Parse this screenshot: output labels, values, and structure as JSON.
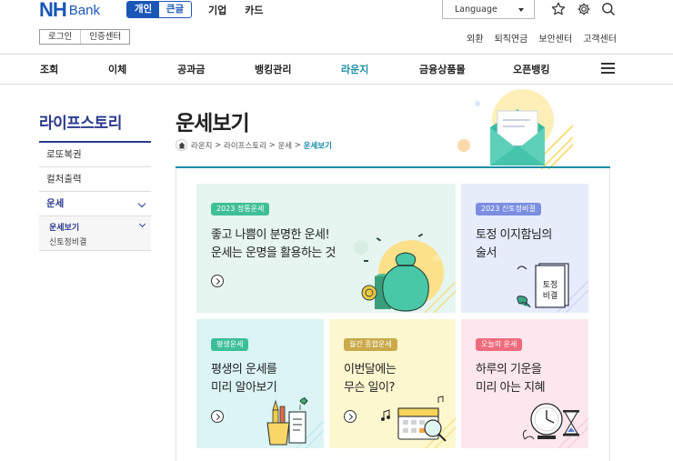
{
  "header": {
    "logo_main": "NH",
    "logo_sub": "Bank",
    "size_toggle": [
      "개인",
      "큰글"
    ],
    "top_links": [
      "기업",
      "카드"
    ],
    "language": "Language",
    "login": "로그인",
    "cert_center": "인증센터",
    "util_links": [
      "외환",
      "퇴직연금",
      "보안센터",
      "고객센터"
    ]
  },
  "gnb": [
    "조회",
    "이체",
    "공과금",
    "뱅킹관리",
    "라운지",
    "금융상품몰",
    "오픈뱅킹"
  ],
  "sidebar": {
    "title": "라이프스토리",
    "items": [
      "로또복권",
      "컬처출력",
      "운세"
    ],
    "sub_items": [
      "운세보기",
      "신토정비결"
    ]
  },
  "main": {
    "title": "운세보기",
    "breadcrumb": [
      "라운지",
      "라이프스토리",
      "운세",
      "운세보기"
    ]
  },
  "cards": [
    {
      "tag": "2023 정통운세",
      "lines": [
        "좋고 나쁨이 분명한 운세!",
        "운세는 운명을 활용하는 것"
      ],
      "bg": "#e6f5ef",
      "tag_color": "#3fbf96"
    },
    {
      "tag": "2023 신토정비결",
      "lines": [
        "토정 이지함님의",
        "술서"
      ],
      "illu_text": [
        "토정",
        "비결"
      ],
      "bg": "#e7ecfb",
      "tag_color": "#7b8ee0"
    },
    {
      "tag": "평생운세",
      "lines": [
        "평생의 운세를",
        "미리 알아보기"
      ],
      "bg": "#dcf4f6",
      "tag_color": "#3cbf97"
    },
    {
      "tag": "월간 종합운세",
      "lines": [
        "이번달에는",
        "무슨 일이?"
      ],
      "bg": "#fdf7cf",
      "tag_color": "#c9a94a"
    },
    {
      "tag": "오늘의 운세",
      "lines": [
        "하루의 기운을",
        "미리 아는 지혜"
      ],
      "bg": "#fde7ee",
      "tag_color": "#ef6b7c"
    }
  ],
  "colors": {
    "brand": "#1a56b8",
    "accent": "#1a8ea8",
    "lnb": "#2b3a8f"
  }
}
